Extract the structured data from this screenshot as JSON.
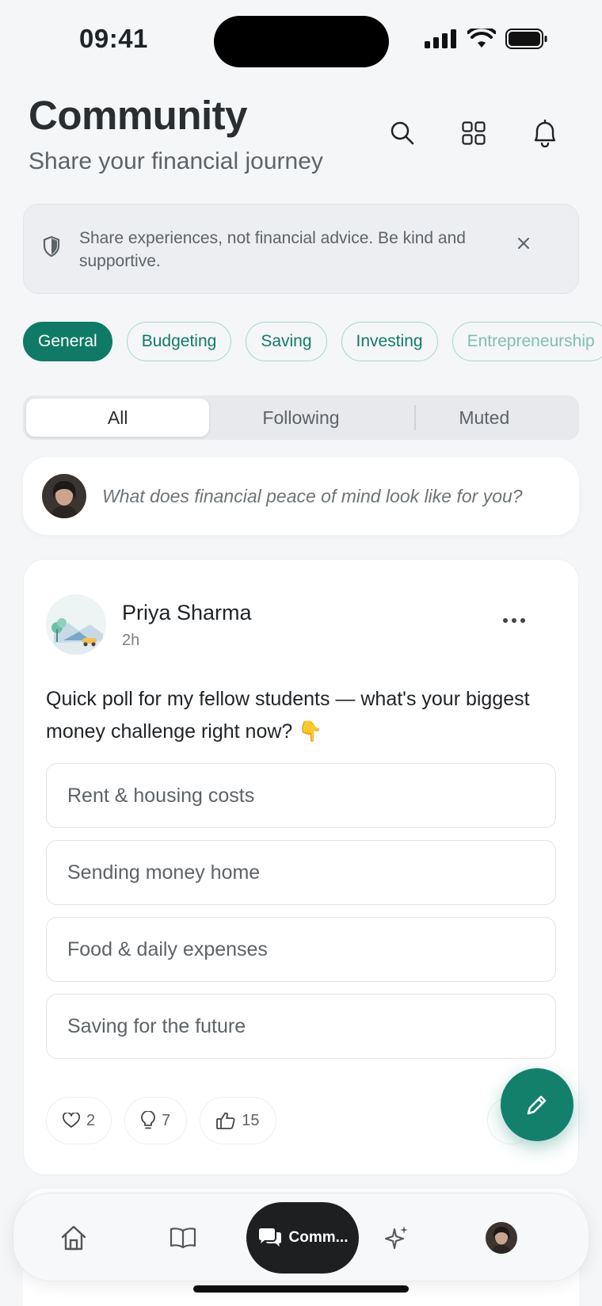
{
  "status_bar": {
    "time": "09:41"
  },
  "header": {
    "title": "Community",
    "subtitle": "Share your financial journey"
  },
  "notice": {
    "text": "Share experiences, not financial advice. Be kind and supportive."
  },
  "categories": [
    "General",
    "Budgeting",
    "Saving",
    "Investing",
    "Entrepreneurship"
  ],
  "feed_filter": {
    "options": [
      "All",
      "Following",
      "Muted"
    ],
    "selected": "All"
  },
  "composer": {
    "prompt": "What does financial peace of mind look like for you?"
  },
  "post": {
    "author": "Priya Sharma",
    "time": "2h",
    "body": "Quick poll for my fellow students — what's your biggest money challenge right now? 👇",
    "poll_options": [
      "Rent & housing costs",
      "Sending money home",
      "Food & daily expenses",
      "Saving for the future"
    ],
    "reactions": {
      "likes": "2",
      "ideas": "7",
      "thumbs_up": "15"
    }
  },
  "tabbar": {
    "items": [
      "home",
      "learn",
      "community",
      "insights",
      "profile"
    ],
    "active_label": "Comm..."
  },
  "colors": {
    "accent": "#0f7a66",
    "fab": "#13806c",
    "background": "#f4f6f8",
    "active_tab": "#1d1f21"
  }
}
